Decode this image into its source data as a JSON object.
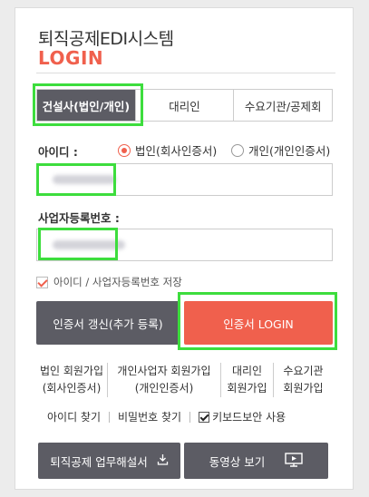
{
  "header": {
    "title": "퇴직공제EDI시스템",
    "login": "LOGIN"
  },
  "tabs": [
    {
      "label": "건설사(법인/개인)",
      "active": true
    },
    {
      "label": "대리인",
      "active": false
    },
    {
      "label": "수요기관/공제회",
      "active": false
    }
  ],
  "id_section": {
    "label": "아이디 :",
    "radios": [
      {
        "label": "법인(회사인증서)",
        "checked": true
      },
      {
        "label": "개인(개인인증서)",
        "checked": false
      }
    ]
  },
  "bizno_section": {
    "label": "사업자등록번호 :"
  },
  "save_checkbox": {
    "label": "아이디 / 사업자등록번호 저장",
    "checked": true
  },
  "buttons": {
    "renew": "인증서 갱신(추가 등록)",
    "login": "인증서 LOGIN"
  },
  "signup_links": [
    {
      "line1": "법인 회원가입",
      "line2": "(회사인증서)"
    },
    {
      "line1": "개인사업자 회원가입",
      "line2": "(개인인증서)"
    },
    {
      "line1": "대리인",
      "line2": "회원가입"
    },
    {
      "line1": "수요기관",
      "line2": "회원가입"
    }
  ],
  "find_links": {
    "find_id": "아이디 찾기",
    "find_pw": "비밀번호 찾기",
    "keyboard_security": "키보드보안 사용"
  },
  "bottom_buttons": {
    "manual": "퇴직공제 업무해설서",
    "video": "동영상 보기"
  },
  "colors": {
    "accent": "#f0604d",
    "dark": "#5c5c64",
    "highlight": "#3ddd3d"
  }
}
